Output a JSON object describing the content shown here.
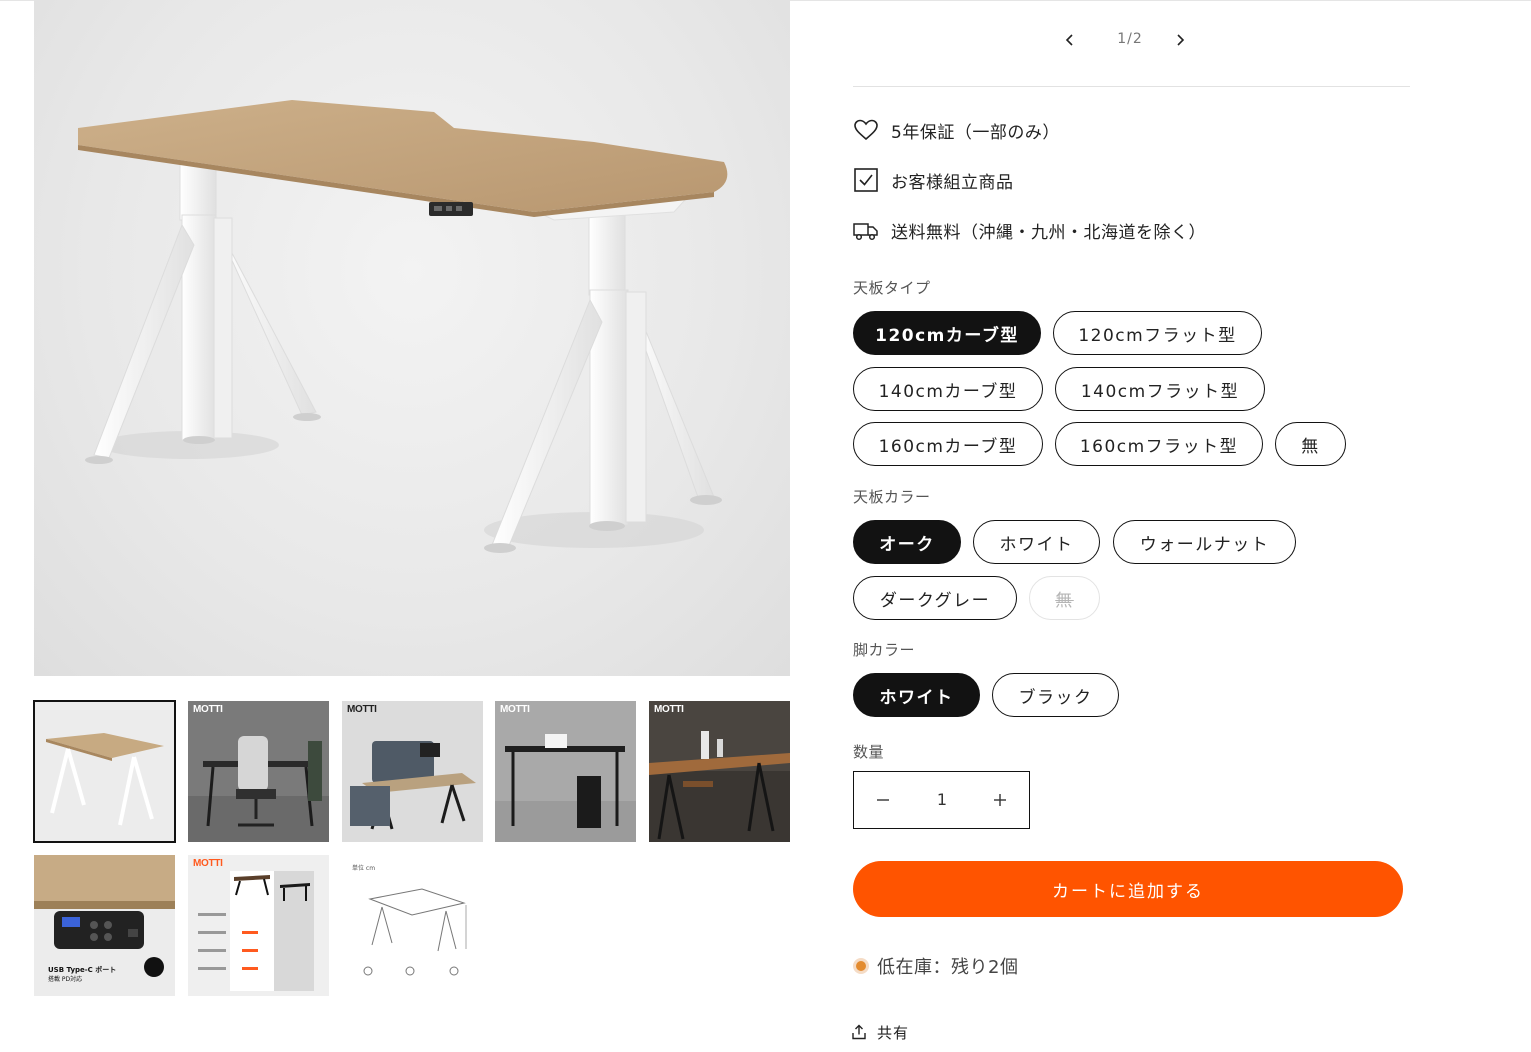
{
  "gallery": {
    "thumbnails": [
      {
        "brand": ""
      },
      {
        "brand": "MOTTI"
      },
      {
        "brand": "MOTTI"
      },
      {
        "brand": "MOTTI"
      },
      {
        "brand": "MOTTI"
      },
      {
        "brand": "",
        "caption_line1": "USB Type-C ポート",
        "caption_line2": "搭載 PD対応"
      },
      {
        "brand": "MOTTI"
      },
      {
        "brand": "",
        "unit": "単位 cm"
      }
    ]
  },
  "pager": {
    "current": "1/2"
  },
  "features": [
    {
      "icon": "heart-icon",
      "text": "5年保証（一部のみ）"
    },
    {
      "icon": "checkbox-icon",
      "text": "お客様組立商品"
    },
    {
      "icon": "truck-icon",
      "text": "送料無料（沖縄・九州・北海道を除く）"
    }
  ],
  "options": {
    "top_type": {
      "label": "天板タイプ",
      "values": [
        "120cmカーブ型",
        "120cmフラット型",
        "140cmカーブ型",
        "140cmフラット型",
        "160cmカーブ型",
        "160cmフラット型",
        "無"
      ],
      "selected": "120cmカーブ型"
    },
    "top_color": {
      "label": "天板カラー",
      "values": [
        "オーク",
        "ホワイト",
        "ウォールナット",
        "ダークグレー",
        "無"
      ],
      "selected": "オーク",
      "unavailable": [
        "無"
      ]
    },
    "leg_color": {
      "label": "脚カラー",
      "values": [
        "ホワイト",
        "ブラック"
      ],
      "selected": "ホワイト"
    }
  },
  "quantity": {
    "label": "数量",
    "value": "1"
  },
  "cart": {
    "label": "カートに追加する",
    "color": "#ff5400"
  },
  "stock": {
    "text": "低在庫：残り2個",
    "color": "#e38b2f"
  },
  "share": {
    "label": "共有"
  }
}
